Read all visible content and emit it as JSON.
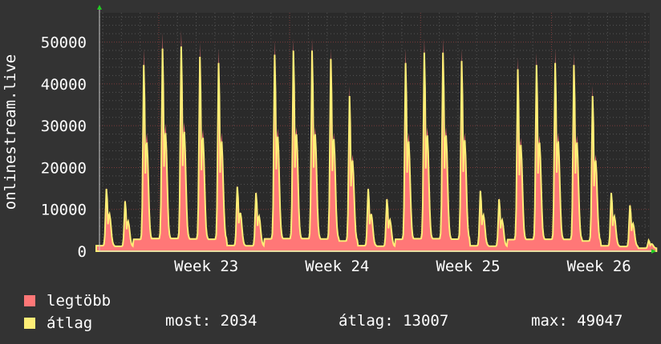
{
  "colors": {
    "background": "#333333",
    "plot_area": "#2a2a2a",
    "grid_minor": "#555555",
    "grid_major": "#7a3a3a",
    "series_max": "#ff7777",
    "series_avg": "#ffee77",
    "axis_arrow": "#22cc22"
  },
  "chart_data": {
    "type": "area",
    "ylabel": "onlinestream.live",
    "ylim": [
      0,
      57000
    ],
    "yticks": [
      0,
      10000,
      20000,
      30000,
      40000,
      50000
    ],
    "ytick_labels": [
      "0",
      "10000",
      "20000",
      "30000",
      "40000",
      "50000"
    ],
    "x_tick_labels": [
      "Week 23",
      "Week 24",
      "Week 25",
      "Week 26"
    ],
    "legend_position": "bottom-left",
    "grid": true,
    "daily_peaks": {
      "x_day": [
        0,
        1,
        2,
        3,
        4,
        5,
        6,
        7,
        8,
        9,
        10,
        11,
        12,
        13,
        14,
        15,
        16,
        17,
        18,
        19,
        20,
        21,
        22,
        23,
        24,
        25,
        26,
        27,
        28,
        29
      ],
      "max": [
        15000,
        12000,
        48500,
        52500,
        53000,
        50000,
        48500,
        15500,
        14000,
        50500,
        51000,
        51000,
        48500,
        39500,
        15000,
        12500,
        48500,
        51000,
        51000,
        48500,
        14500,
        12500,
        46500,
        47500,
        48500,
        47500,
        39500,
        14000,
        11000,
        2000
      ],
      "avg": [
        14500,
        11500,
        44500,
        48500,
        49000,
        46500,
        45000,
        15000,
        13500,
        47000,
        48000,
        48000,
        46000,
        37000,
        14500,
        12000,
        45000,
        47500,
        47500,
        45500,
        14000,
        12000,
        43500,
        44500,
        45000,
        44500,
        37000,
        13500,
        10500,
        2000
      ]
    },
    "series": [
      {
        "name": "legtöbb"
      },
      {
        "name": "átlag"
      }
    ]
  },
  "legend": {
    "max_label": "legtöbb",
    "avg_label": "átlag"
  },
  "stats": {
    "current": "most: 2034",
    "average": "átlag: 13007",
    "maximum": "max: 49047"
  }
}
